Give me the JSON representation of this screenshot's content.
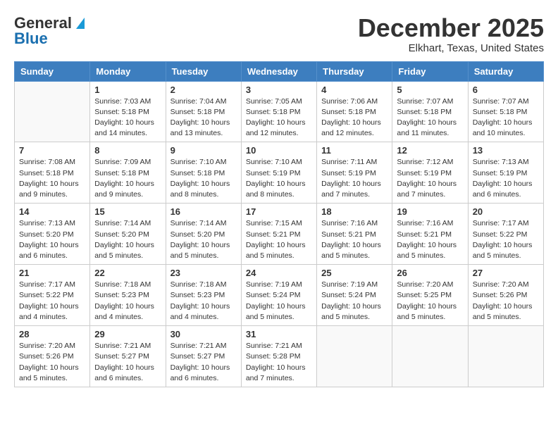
{
  "header": {
    "logo_general": "General",
    "logo_blue": "Blue",
    "month_title": "December 2025",
    "location": "Elkhart, Texas, United States"
  },
  "days_of_week": [
    "Sunday",
    "Monday",
    "Tuesday",
    "Wednesday",
    "Thursday",
    "Friday",
    "Saturday"
  ],
  "weeks": [
    [
      {
        "day": "",
        "sunrise": "",
        "sunset": "",
        "daylight": ""
      },
      {
        "day": "1",
        "sunrise": "Sunrise: 7:03 AM",
        "sunset": "Sunset: 5:18 PM",
        "daylight": "Daylight: 10 hours and 14 minutes."
      },
      {
        "day": "2",
        "sunrise": "Sunrise: 7:04 AM",
        "sunset": "Sunset: 5:18 PM",
        "daylight": "Daylight: 10 hours and 13 minutes."
      },
      {
        "day": "3",
        "sunrise": "Sunrise: 7:05 AM",
        "sunset": "Sunset: 5:18 PM",
        "daylight": "Daylight: 10 hours and 12 minutes."
      },
      {
        "day": "4",
        "sunrise": "Sunrise: 7:06 AM",
        "sunset": "Sunset: 5:18 PM",
        "daylight": "Daylight: 10 hours and 12 minutes."
      },
      {
        "day": "5",
        "sunrise": "Sunrise: 7:07 AM",
        "sunset": "Sunset: 5:18 PM",
        "daylight": "Daylight: 10 hours and 11 minutes."
      },
      {
        "day": "6",
        "sunrise": "Sunrise: 7:07 AM",
        "sunset": "Sunset: 5:18 PM",
        "daylight": "Daylight: 10 hours and 10 minutes."
      }
    ],
    [
      {
        "day": "7",
        "sunrise": "Sunrise: 7:08 AM",
        "sunset": "Sunset: 5:18 PM",
        "daylight": "Daylight: 10 hours and 9 minutes."
      },
      {
        "day": "8",
        "sunrise": "Sunrise: 7:09 AM",
        "sunset": "Sunset: 5:18 PM",
        "daylight": "Daylight: 10 hours and 9 minutes."
      },
      {
        "day": "9",
        "sunrise": "Sunrise: 7:10 AM",
        "sunset": "Sunset: 5:18 PM",
        "daylight": "Daylight: 10 hours and 8 minutes."
      },
      {
        "day": "10",
        "sunrise": "Sunrise: 7:10 AM",
        "sunset": "Sunset: 5:19 PM",
        "daylight": "Daylight: 10 hours and 8 minutes."
      },
      {
        "day": "11",
        "sunrise": "Sunrise: 7:11 AM",
        "sunset": "Sunset: 5:19 PM",
        "daylight": "Daylight: 10 hours and 7 minutes."
      },
      {
        "day": "12",
        "sunrise": "Sunrise: 7:12 AM",
        "sunset": "Sunset: 5:19 PM",
        "daylight": "Daylight: 10 hours and 7 minutes."
      },
      {
        "day": "13",
        "sunrise": "Sunrise: 7:13 AM",
        "sunset": "Sunset: 5:19 PM",
        "daylight": "Daylight: 10 hours and 6 minutes."
      }
    ],
    [
      {
        "day": "14",
        "sunrise": "Sunrise: 7:13 AM",
        "sunset": "Sunset: 5:20 PM",
        "daylight": "Daylight: 10 hours and 6 minutes."
      },
      {
        "day": "15",
        "sunrise": "Sunrise: 7:14 AM",
        "sunset": "Sunset: 5:20 PM",
        "daylight": "Daylight: 10 hours and 5 minutes."
      },
      {
        "day": "16",
        "sunrise": "Sunrise: 7:14 AM",
        "sunset": "Sunset: 5:20 PM",
        "daylight": "Daylight: 10 hours and 5 minutes."
      },
      {
        "day": "17",
        "sunrise": "Sunrise: 7:15 AM",
        "sunset": "Sunset: 5:21 PM",
        "daylight": "Daylight: 10 hours and 5 minutes."
      },
      {
        "day": "18",
        "sunrise": "Sunrise: 7:16 AM",
        "sunset": "Sunset: 5:21 PM",
        "daylight": "Daylight: 10 hours and 5 minutes."
      },
      {
        "day": "19",
        "sunrise": "Sunrise: 7:16 AM",
        "sunset": "Sunset: 5:21 PM",
        "daylight": "Daylight: 10 hours and 5 minutes."
      },
      {
        "day": "20",
        "sunrise": "Sunrise: 7:17 AM",
        "sunset": "Sunset: 5:22 PM",
        "daylight": "Daylight: 10 hours and 5 minutes."
      }
    ],
    [
      {
        "day": "21",
        "sunrise": "Sunrise: 7:17 AM",
        "sunset": "Sunset: 5:22 PM",
        "daylight": "Daylight: 10 hours and 4 minutes."
      },
      {
        "day": "22",
        "sunrise": "Sunrise: 7:18 AM",
        "sunset": "Sunset: 5:23 PM",
        "daylight": "Daylight: 10 hours and 4 minutes."
      },
      {
        "day": "23",
        "sunrise": "Sunrise: 7:18 AM",
        "sunset": "Sunset: 5:23 PM",
        "daylight": "Daylight: 10 hours and 4 minutes."
      },
      {
        "day": "24",
        "sunrise": "Sunrise: 7:19 AM",
        "sunset": "Sunset: 5:24 PM",
        "daylight": "Daylight: 10 hours and 5 minutes."
      },
      {
        "day": "25",
        "sunrise": "Sunrise: 7:19 AM",
        "sunset": "Sunset: 5:24 PM",
        "daylight": "Daylight: 10 hours and 5 minutes."
      },
      {
        "day": "26",
        "sunrise": "Sunrise: 7:20 AM",
        "sunset": "Sunset: 5:25 PM",
        "daylight": "Daylight: 10 hours and 5 minutes."
      },
      {
        "day": "27",
        "sunrise": "Sunrise: 7:20 AM",
        "sunset": "Sunset: 5:26 PM",
        "daylight": "Daylight: 10 hours and 5 minutes."
      }
    ],
    [
      {
        "day": "28",
        "sunrise": "Sunrise: 7:20 AM",
        "sunset": "Sunset: 5:26 PM",
        "daylight": "Daylight: 10 hours and 5 minutes."
      },
      {
        "day": "29",
        "sunrise": "Sunrise: 7:21 AM",
        "sunset": "Sunset: 5:27 PM",
        "daylight": "Daylight: 10 hours and 6 minutes."
      },
      {
        "day": "30",
        "sunrise": "Sunrise: 7:21 AM",
        "sunset": "Sunset: 5:27 PM",
        "daylight": "Daylight: 10 hours and 6 minutes."
      },
      {
        "day": "31",
        "sunrise": "Sunrise: 7:21 AM",
        "sunset": "Sunset: 5:28 PM",
        "daylight": "Daylight: 10 hours and 7 minutes."
      },
      {
        "day": "",
        "sunrise": "",
        "sunset": "",
        "daylight": ""
      },
      {
        "day": "",
        "sunrise": "",
        "sunset": "",
        "daylight": ""
      },
      {
        "day": "",
        "sunrise": "",
        "sunset": "",
        "daylight": ""
      }
    ]
  ]
}
